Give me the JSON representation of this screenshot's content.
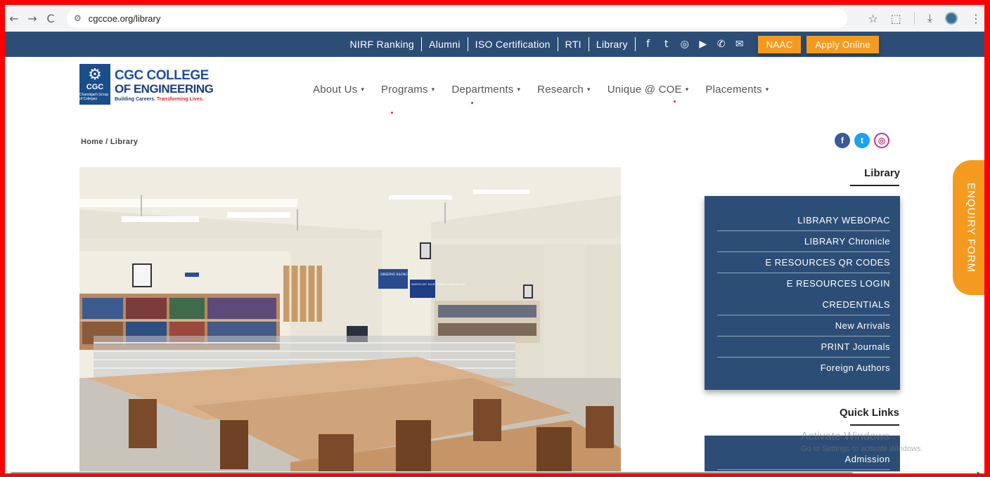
{
  "browser": {
    "back": "←",
    "forward": "→",
    "reload": "C",
    "site_info_icon": "⚙",
    "url": "cgccoe.org/library",
    "star": "☆",
    "extensions": "⬚",
    "download": "⤓",
    "menu": "⋮"
  },
  "topbar": {
    "links": [
      "NIRF Ranking",
      "Alumni",
      "ISO Certification",
      "RTI",
      "Library"
    ],
    "social_icons": [
      "f",
      "t",
      "◎",
      "▶",
      "✆",
      "✉"
    ],
    "naac_label": "NAAC",
    "apply_label": "Apply Online"
  },
  "logo": {
    "emblem_text": "CGC",
    "emblem_sub": "Chandigarh Group of Colleges",
    "line1": "CGC COLLEGE",
    "line2": "OF ENGINEERING",
    "tagline_a": "Building Careers. ",
    "tagline_b": "Transforming Lives."
  },
  "nav": {
    "items": [
      "About Us",
      "Programs",
      "Departments",
      "Research",
      "Unique @ COE",
      "Placements"
    ],
    "caret": "▾"
  },
  "breadcrumb": "Home  / Library",
  "share": [
    "f",
    "t",
    "◎"
  ],
  "sidebar": {
    "title": "Library",
    "items": [
      "LIBRARY WEBOPAC",
      "LIBRARY Chronicle",
      "E RESOURCES QR CODES",
      "E RESOURCES LOGIN",
      "CREDENTIALS",
      "New Arrivals",
      "PRINT Journals",
      "Foreign Authors"
    ]
  },
  "quick_links": {
    "title": "Quick Links",
    "first_item": "Admission"
  },
  "enquiry_label": "ENQUIRY FORM",
  "watermark": {
    "line1": "Activate Windows",
    "line2": "Go to Settings to activate Windows."
  },
  "photo_signs": {
    "sign1": "OBSERVE SILENCE",
    "sign2": "SWITCH OFF YOUR MOBILE PHONE PLEASE"
  },
  "colors": {
    "navy": "#2c4e76",
    "orange": "#f49b1f",
    "frame": "#ff0000"
  }
}
